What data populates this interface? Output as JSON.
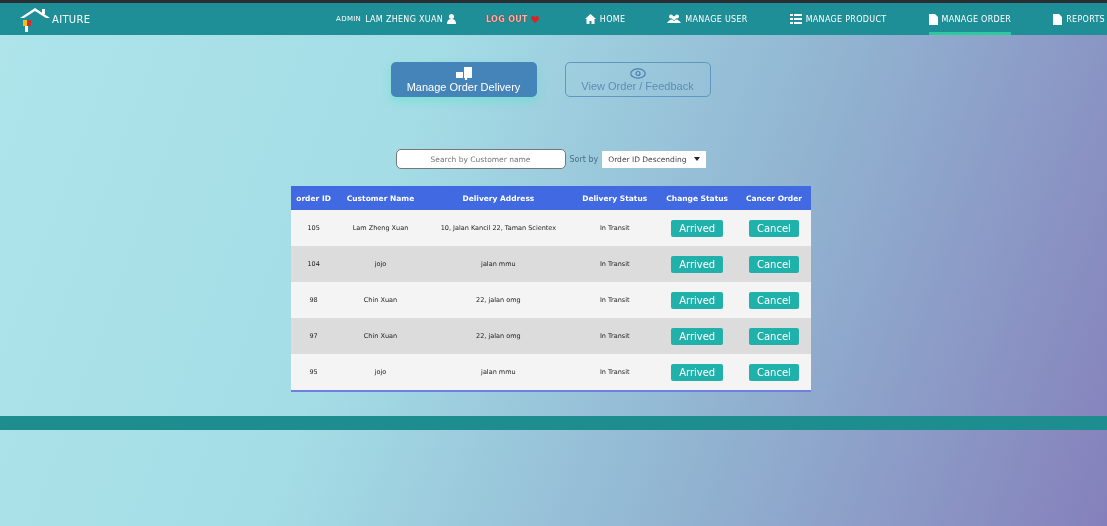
{
  "brand": {
    "name": "AITURE"
  },
  "nav": {
    "role": "ADMIN",
    "user": "LAM ZHENG XUAN",
    "logout": "LOG OUT",
    "links": [
      {
        "label": "HOME",
        "selected": false
      },
      {
        "label": "MANAGE USER",
        "selected": false
      },
      {
        "label": "MANAGE PRODUCT",
        "selected": false
      },
      {
        "label": "MANAGE ORDER",
        "selected": true
      },
      {
        "label": "REPORTS",
        "selected": false
      }
    ]
  },
  "views": [
    {
      "label": "Manage Order Delivery",
      "selected": true
    },
    {
      "label": "View Order / Feedback",
      "selected": false
    }
  ],
  "search": {
    "placeholder": "Search by Customer name"
  },
  "sort": {
    "label": "Sort by",
    "value": "Order ID Descending"
  },
  "table": {
    "columns": [
      "order ID",
      "Customer Name",
      "Delivery Address",
      "Delivery Status",
      "Change Status",
      "Cancer Order"
    ],
    "rows": [
      {
        "id": "105",
        "name": "Lam Zheng Xuan",
        "address": "10, Jalan Kancil 22, Taman Scientex",
        "status": "In Transit",
        "action": "Arrived",
        "cancel": "Cancel"
      },
      {
        "id": "104",
        "name": "jojo",
        "address": "jalan mmu",
        "status": "In Transit",
        "action": "Arrived",
        "cancel": "Cancel"
      },
      {
        "id": "98",
        "name": "Chin Xuan",
        "address": "22, jalan omg",
        "status": "In Transit",
        "action": "Arrived",
        "cancel": "Cancel"
      },
      {
        "id": "97",
        "name": "Chin Xuan",
        "address": "22, jalan omg",
        "status": "In Transit",
        "action": "Arrived",
        "cancel": "Cancel"
      },
      {
        "id": "95",
        "name": "jojo",
        "address": "jalan mmu",
        "status": "In Transit",
        "action": "Arrived",
        "cancel": "Cancel"
      }
    ]
  }
}
